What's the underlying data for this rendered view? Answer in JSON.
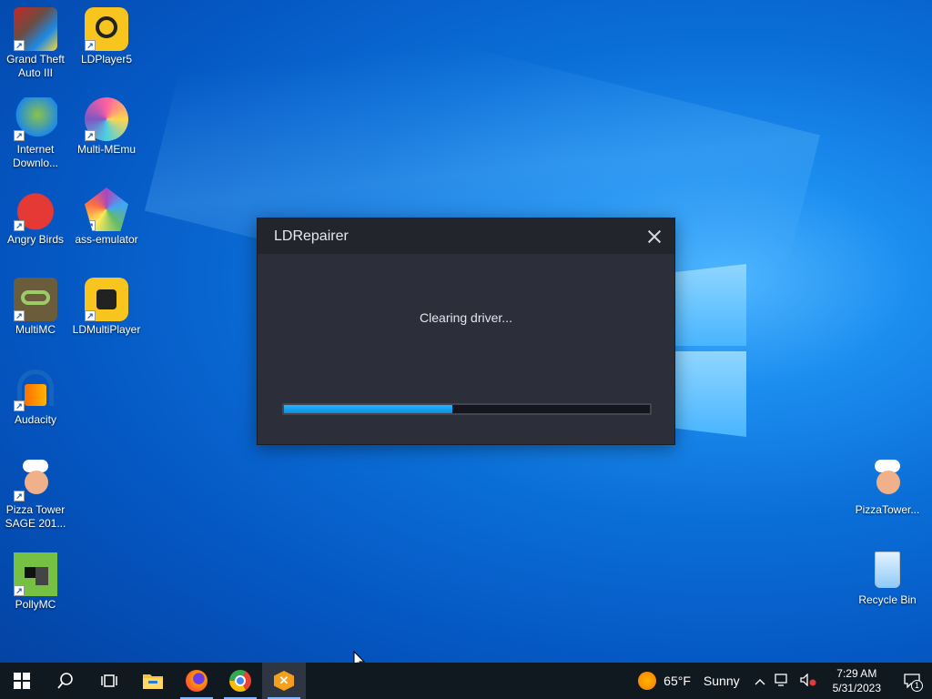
{
  "desktop": {
    "icons": [
      {
        "label": "Grand Theft Auto III",
        "icon": "gta3-icon"
      },
      {
        "label": "LDPlayer5",
        "icon": "ldplayer5-icon"
      },
      {
        "label": "Internet Downlo...",
        "icon": "internet-download-manager-icon"
      },
      {
        "label": "Multi-MEmu",
        "icon": "multi-memu-icon"
      },
      {
        "label": "Angry Birds",
        "icon": "angry-birds-icon"
      },
      {
        "label": "ass-emulator",
        "icon": "ass-emulator-icon"
      },
      {
        "label": "MultiMC",
        "icon": "multimc-icon"
      },
      {
        "label": "LDMultiPlayer",
        "icon": "ldmultiplayer-icon"
      },
      {
        "label": "Audacity",
        "icon": "audacity-icon"
      },
      {
        "label": "Pizza Tower SAGE 201...",
        "icon": "pizza-tower-icon"
      },
      {
        "label": "PollyMC",
        "icon": "pollymc-icon"
      },
      {
        "label": "PizzaTower...",
        "icon": "pizza-tower-icon"
      },
      {
        "label": "Recycle Bin",
        "icon": "recycle-bin-icon"
      }
    ]
  },
  "dialog": {
    "title": "LDRepairer",
    "status": "Clearing driver...",
    "progress": 0.46
  },
  "taskbar": {
    "weather_temp": "65°F",
    "weather_desc": "Sunny",
    "time": "7:29 AM",
    "date": "5/31/2023",
    "notification_count": "1"
  },
  "colors": {
    "accent": "#1ea7f5",
    "dialog_bg": "#2c2f3a",
    "taskbar_bg": "#101820"
  }
}
